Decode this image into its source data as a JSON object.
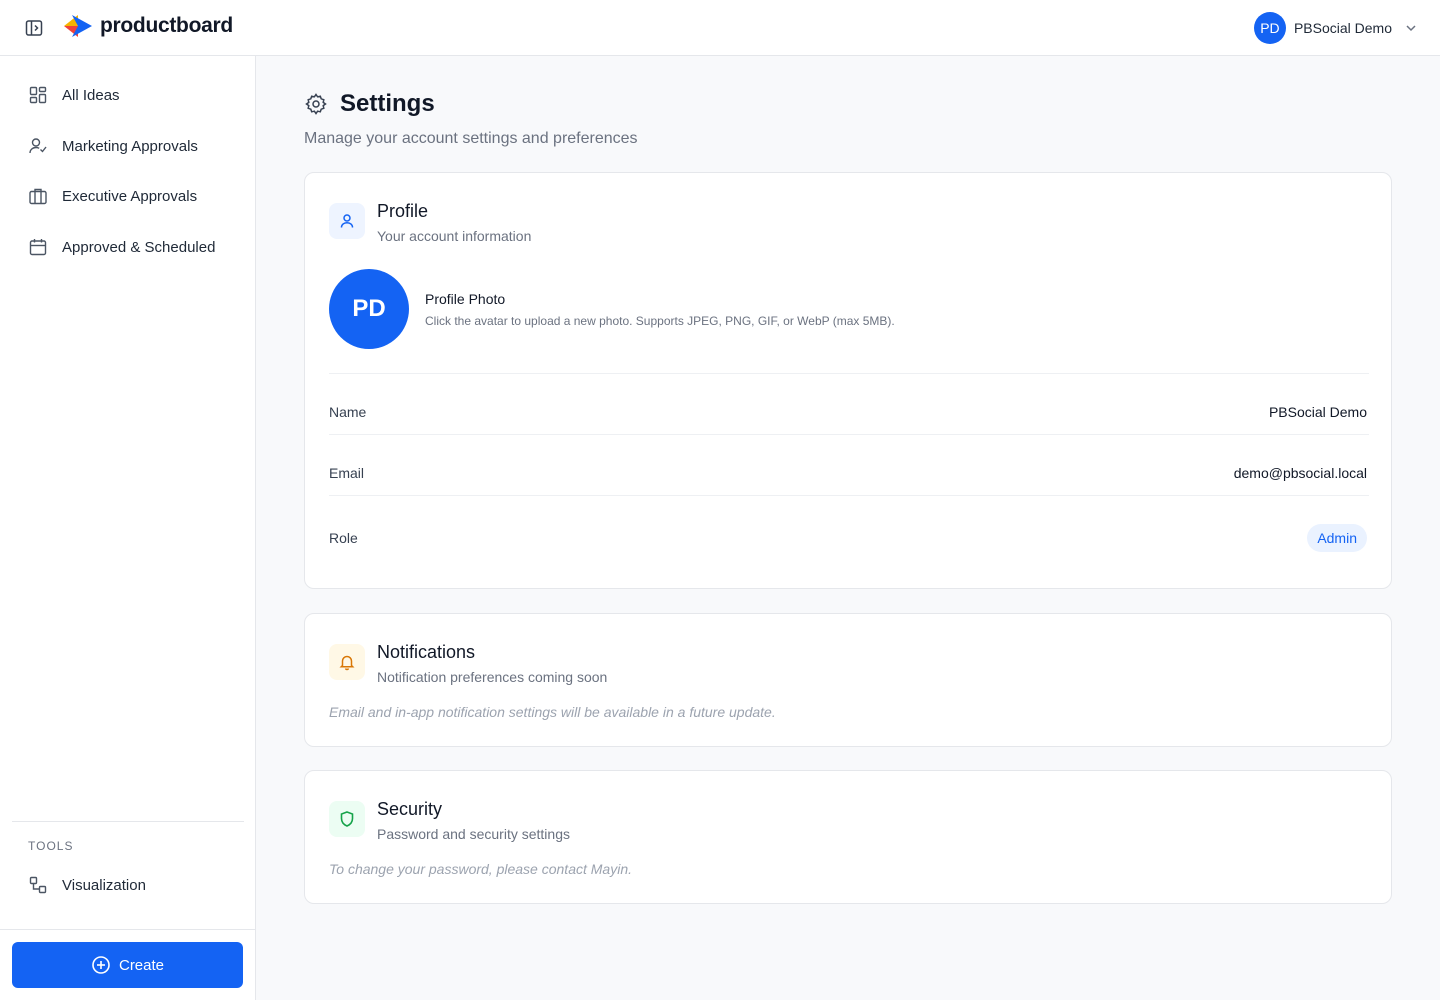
{
  "app": {
    "logo_text": "productboard",
    "sidebar_toggle_icon": "sidebar-toggle-icon"
  },
  "user": {
    "initials": "PD",
    "name": "PBSocial Demo"
  },
  "sidebar": {
    "items": [
      {
        "label": "All Ideas",
        "icon": "grid-icon"
      },
      {
        "label": "Marketing Approvals",
        "icon": "user-check-icon"
      },
      {
        "label": "Executive Approvals",
        "icon": "briefcase-icon"
      },
      {
        "label": "Approved & Scheduled",
        "icon": "calendar-icon"
      }
    ],
    "tools_heading": "TOOLS",
    "tools": [
      {
        "label": "Visualization",
        "icon": "diagram-icon"
      }
    ],
    "create_label": "Create"
  },
  "page": {
    "title": "Settings",
    "subtitle": "Manage your account settings and preferences"
  },
  "profile": {
    "title": "Profile",
    "subtitle": "Your account information",
    "photo_title": "Profile Photo",
    "photo_hint": "Click the avatar to upload a new photo. Supports JPEG, PNG, GIF, or WebP (max 5MB).",
    "avatar_initials": "PD",
    "fields": {
      "name_label": "Name",
      "name_value": "PBSocial Demo",
      "email_label": "Email",
      "email_value": "demo@pbsocial.local",
      "role_label": "Role",
      "role_value": "Admin"
    }
  },
  "notifications": {
    "title": "Notifications",
    "subtitle": "Notification preferences coming soon",
    "note": "Email and in-app notification settings will be available in a future update."
  },
  "security": {
    "title": "Security",
    "subtitle": "Password and security settings",
    "note": "To change your password, please contact Mayin."
  },
  "colors": {
    "accent": "#1463f3",
    "notification_icon": "#d97706",
    "security_icon": "#16a34a"
  }
}
